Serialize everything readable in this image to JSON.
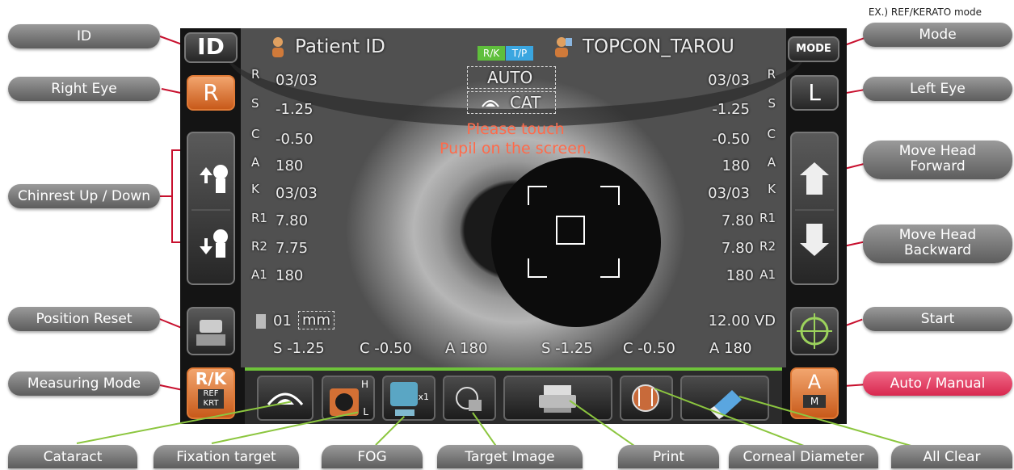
{
  "caption": "EX.) REF/KERATO mode",
  "callouts": {
    "id": "ID",
    "right_eye": "Right Eye",
    "chinrest": "Chinrest Up / Down",
    "position_reset": "Position Reset",
    "measuring_mode": "Measuring Mode",
    "mode": "Mode",
    "left_eye": "Left Eye",
    "move_forward": "Move Head\nForward",
    "move_backward": "Move Head\nBackward",
    "start": "Start",
    "auto_manual": "Auto / Manual",
    "cataract": "Cataract",
    "fixation": "Fixation target",
    "fog": "FOG",
    "target_image": "Target Image",
    "print": "Print",
    "corneal": "Corneal Diameter",
    "all_clear": "All Clear"
  },
  "screen": {
    "id_button": "ID",
    "patient_id": "Patient ID",
    "rk_badge": "R/K",
    "tp_badge": "T/P",
    "patient_name": "TOPCON_TAROU",
    "mode_button": "MODE",
    "right_button": "R",
    "left_button": "L",
    "auto_label": "AUTO",
    "cat_label": "CAT",
    "message_line1": "Please touch",
    "message_line2": "Pupil on the screen.",
    "mm_label": "mm",
    "index": "01",
    "vd": "12.00 VD",
    "rk_button": "R/K",
    "ref_label": "REF",
    "krt_label": "KRT",
    "a_button": "A",
    "m_label": "M",
    "h_label": "H",
    "l_label": "L",
    "x1_label": "x1"
  },
  "left_values": [
    {
      "label": "R",
      "value": "03/03"
    },
    {
      "label": "S",
      "value": "-1.25"
    },
    {
      "label": "C",
      "value": "-0.50"
    },
    {
      "label": "A",
      "value": "180"
    },
    {
      "label": "K",
      "value": "03/03"
    },
    {
      "label": "R1",
      "value": "7.80"
    },
    {
      "label": "R2",
      "value": "7.75"
    },
    {
      "label": "A1",
      "value": "180"
    }
  ],
  "right_values": [
    {
      "label": "R",
      "value": "03/03"
    },
    {
      "label": "S",
      "value": "-1.25"
    },
    {
      "label": "C",
      "value": "-0.50"
    },
    {
      "label": "A",
      "value": "180"
    },
    {
      "label": "K",
      "value": "03/03"
    },
    {
      "label": "R1",
      "value": "7.80"
    },
    {
      "label": "R2",
      "value": "7.80"
    },
    {
      "label": "A1",
      "value": "180"
    }
  ],
  "summary": {
    "right": {
      "s": "S -1.25",
      "c": "C -0.50",
      "a": "A 180"
    },
    "left": {
      "s": "S -1.25",
      "c": "C -0.50",
      "a": "A 180"
    }
  },
  "colors": {
    "accent_green": "#6ec33a",
    "orange": "#e07a36",
    "callout_red": "#d8284f",
    "line_red": "#c8102e",
    "line_green": "#8cc63f"
  }
}
